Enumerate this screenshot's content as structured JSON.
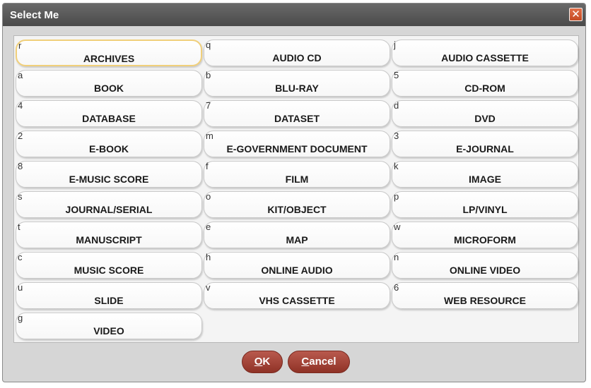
{
  "dialog": {
    "title": "Select Me",
    "close_symbol": "✕"
  },
  "options": [
    {
      "key": "r",
      "label": "ARCHIVES",
      "focused": true
    },
    {
      "key": "q",
      "label": "AUDIO CD"
    },
    {
      "key": "j",
      "label": "AUDIO CASSETTE"
    },
    {
      "key": "a",
      "label": "BOOK"
    },
    {
      "key": "b",
      "label": "BLU-RAY"
    },
    {
      "key": "5",
      "label": "CD-ROM"
    },
    {
      "key": "4",
      "label": "DATABASE"
    },
    {
      "key": "7",
      "label": "DATASET"
    },
    {
      "key": "d",
      "label": "DVD"
    },
    {
      "key": "2",
      "label": "E-BOOK"
    },
    {
      "key": "m",
      "label": "E-GOVERNMENT DOCUMENT"
    },
    {
      "key": "3",
      "label": "E-JOURNAL"
    },
    {
      "key": "8",
      "label": "E-MUSIC SCORE"
    },
    {
      "key": "f",
      "label": "FILM"
    },
    {
      "key": "k",
      "label": "IMAGE"
    },
    {
      "key": "s",
      "label": "JOURNAL/SERIAL"
    },
    {
      "key": "o",
      "label": "KIT/OBJECT"
    },
    {
      "key": "p",
      "label": "LP/VINYL"
    },
    {
      "key": "t",
      "label": "MANUSCRIPT"
    },
    {
      "key": "e",
      "label": "MAP"
    },
    {
      "key": "w",
      "label": "MICROFORM"
    },
    {
      "key": "c",
      "label": "MUSIC SCORE"
    },
    {
      "key": "h",
      "label": "ONLINE AUDIO"
    },
    {
      "key": "n",
      "label": "ONLINE VIDEO"
    },
    {
      "key": "u",
      "label": "SLIDE"
    },
    {
      "key": "v",
      "label": "VHS CASSETTE"
    },
    {
      "key": "6",
      "label": "WEB RESOURCE"
    },
    {
      "key": "g",
      "label": "VIDEO"
    }
  ],
  "footer": {
    "ok_access": "O",
    "ok_rest": "K",
    "cancel_access": "C",
    "cancel_rest": "ancel"
  },
  "colors": {
    "titlebar": "#555555",
    "close_button": "#d4592f",
    "action_button": "#a8473a",
    "focus_outline": "#f0cf7a"
  }
}
